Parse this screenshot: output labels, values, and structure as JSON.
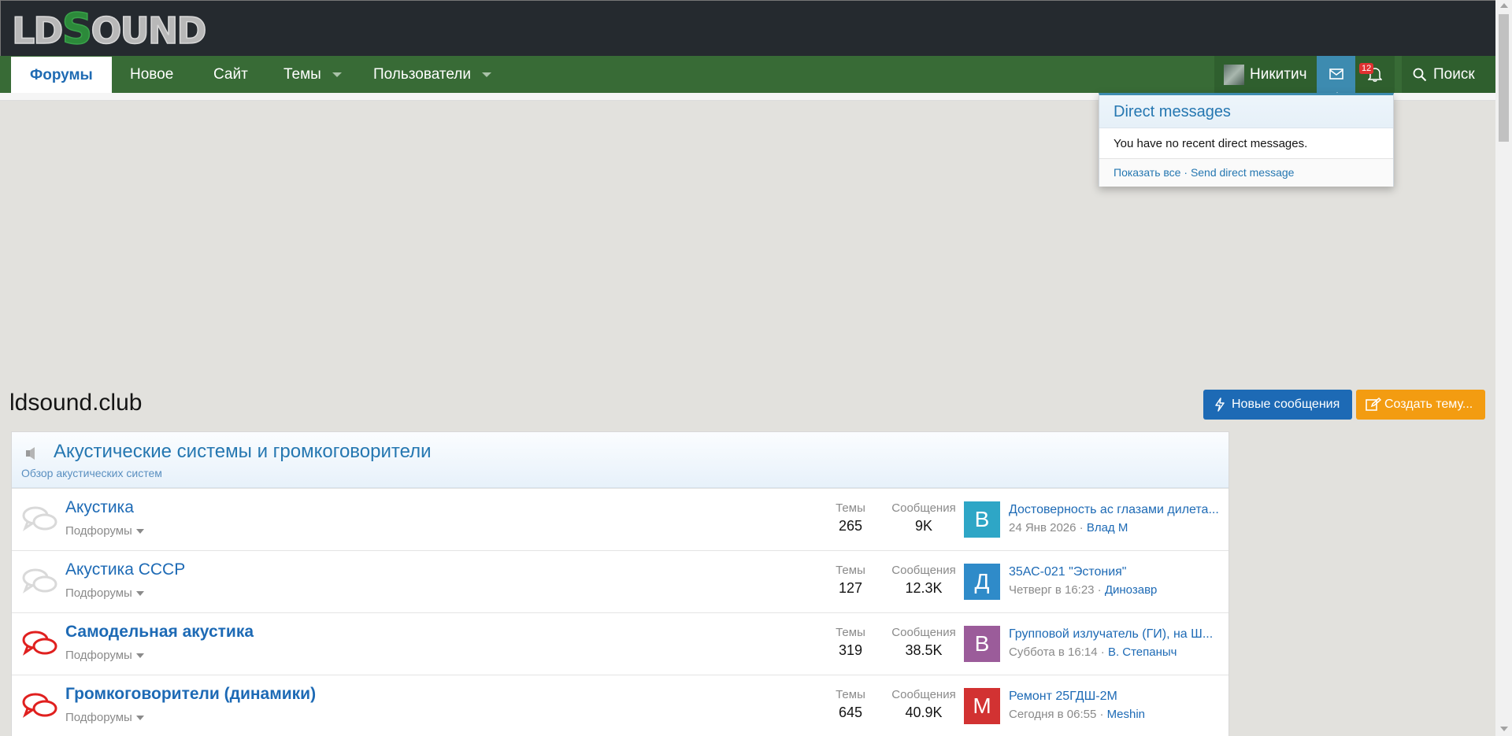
{
  "header": {
    "logo_text_a": "LD",
    "logo_text_s": "S",
    "logo_text_b": "OUND"
  },
  "nav": {
    "tabs": [
      {
        "label": "Форумы",
        "active": true
      },
      {
        "label": "Новое"
      },
      {
        "label": "Сайт"
      },
      {
        "label": "Темы",
        "dropdown": true
      },
      {
        "label": "Пользователи",
        "dropdown": true
      }
    ],
    "user_name": "Никитич",
    "notifications_count": "12",
    "search_label": "Поиск"
  },
  "dm_popup": {
    "title": "Direct messages",
    "body": "You have no recent direct messages.",
    "show_all": "Показать все",
    "separator": "·",
    "send": "Send direct message"
  },
  "page": {
    "title": "ldsound.club",
    "btn_new": "Новые сообщения",
    "btn_create": "Создать тему..."
  },
  "category": {
    "title": "Акустические системы и громкоговорители",
    "description": "Обзор акустических систем"
  },
  "forums": [
    {
      "title": "Акустика",
      "bold": false,
      "unread": false,
      "subforums": "Подфорумы",
      "topics_label": "Темы",
      "topics": "265",
      "posts_label": "Сообщения",
      "posts": "9K",
      "avatar_letter": "В",
      "avatar_color": "#2ea6c6",
      "last_title": "Достоверность ас глазами дилета...",
      "last_date": "24 Янв 2026",
      "last_author": "Влад М"
    },
    {
      "title": "Акустика СССР",
      "bold": false,
      "unread": false,
      "subforums": "Подфорумы",
      "topics_label": "Темы",
      "topics": "127",
      "posts_label": "Сообщения",
      "posts": "12.3K",
      "avatar_letter": "Д",
      "avatar_color": "#2f8bc9",
      "last_title": "35АС-021 \"Эстония\"",
      "last_date": "Четверг в 16:23",
      "last_author": "Динозавр"
    },
    {
      "title": "Самодельная акустика",
      "bold": true,
      "unread": true,
      "subforums": "Подфорумы",
      "topics_label": "Темы",
      "topics": "319",
      "posts_label": "Сообщения",
      "posts": "38.5K",
      "avatar_letter": "В",
      "avatar_color": "#9b5c9a",
      "last_title": "Групповой излучатель (ГИ), на Ш...",
      "last_date": "Суббота в 16:14",
      "last_author": "В. Степаныч"
    },
    {
      "title": "Громкоговорители (динамики)",
      "bold": true,
      "unread": true,
      "subforums": "Подфорумы",
      "topics_label": "Темы",
      "topics": "645",
      "posts_label": "Сообщения",
      "posts": "40.9K",
      "avatar_letter": "М",
      "avatar_color": "#d23232",
      "last_title": "Ремонт 25ГДШ-2М",
      "last_date": "Сегодня в 06:55",
      "last_author": "Meshin"
    }
  ],
  "colors": {
    "header_bg": "#252a2f",
    "nav_bg": "#386b36",
    "link": "#1d6ab5",
    "btn_new": "#1d6ab5",
    "btn_create": "#f39c11",
    "badge": "#e03131"
  }
}
